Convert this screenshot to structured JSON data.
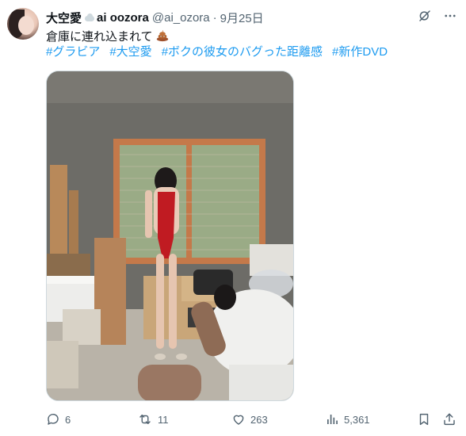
{
  "author": {
    "display_name": "大空愛",
    "display_name_suffix": "ai oozora",
    "handle": "@ai_ozora",
    "separator": "·",
    "date": "9月25日"
  },
  "tweet": {
    "text": "倉庫に連れ込まれて",
    "trailing_emoji": "poop-emoji",
    "hashtags": [
      "#グラビア",
      "#大空愛",
      "#ボクの彼女のバグった距離感",
      "#新作DVD"
    ]
  },
  "header_icons": [
    "grok-icon",
    "more-icon"
  ],
  "actions": {
    "replies": "6",
    "retweets": "11",
    "likes": "263",
    "views": "5,361"
  },
  "colors": {
    "link": "#1d9bf0",
    "secondary_text": "#536471",
    "primary_text": "#0f1419"
  }
}
